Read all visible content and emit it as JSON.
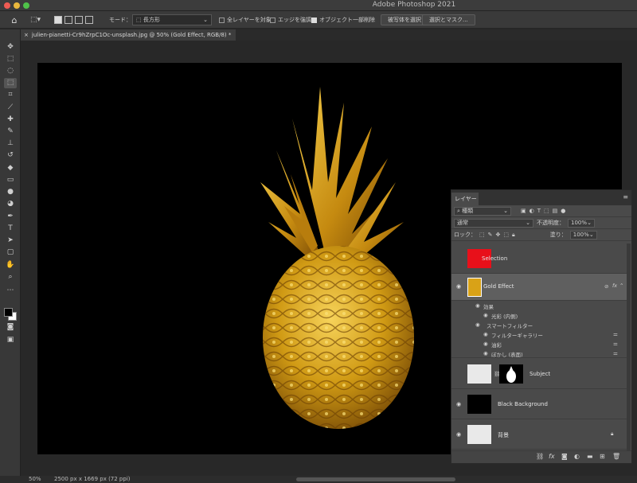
{
  "app": {
    "title": "Adobe Photoshop 2021"
  },
  "options_bar": {
    "mode_label": "モード：",
    "mode_value": "長方形",
    "sample_all_layers": "全レイヤーを対象",
    "sample_all_layers_checked": false,
    "enhance_edge": "エッジを強調",
    "enhance_edge_checked": false,
    "object_subtract": "オブジェクト一部削除",
    "object_subtract_checked": true,
    "select_subject_label": "被写体を選択",
    "select_and_mask_label": "選択とマスク..."
  },
  "document": {
    "tab_title": "julien-pianetti-Cr9hZrpC1Oc-unsplash.jpg @ 50% (Gold Effect, RGB/8) *",
    "tab_close": "×"
  },
  "status": {
    "zoom": "50%",
    "doc_size": "2500 px x 1669 px (72 ppi)"
  },
  "layers_panel": {
    "tab_label": "レイヤー",
    "filter_kind": "種類",
    "blend_mode": "通常",
    "opacity_label": "不透明度：",
    "opacity_value": "100%",
    "lock_label": "ロック：",
    "fill_label": "塗り：",
    "fill_value": "100%",
    "layers": [
      {
        "name": "Selection",
        "visible": false
      },
      {
        "name": "Gold Effect",
        "visible": true,
        "selected": true,
        "fx_label": "fx"
      },
      {
        "name": "Subject",
        "visible": false
      },
      {
        "name": "Black Background",
        "visible": true
      },
      {
        "name": "背景",
        "visible": true
      }
    ],
    "effects": {
      "effects_label": "効果",
      "inner_glow": "光彩 (内側)",
      "smart_filters": "スマートフィルター",
      "filter_gallery": "フィルターギャラリー",
      "posterize": "油彩",
      "blur_surface": "ぼかし (表面)"
    },
    "footer_fx": "fx"
  },
  "colors": {
    "foreground": "#000000",
    "background": "#ffffff",
    "selection_thumb": "#e8101a",
    "gold": "#d9a217"
  }
}
